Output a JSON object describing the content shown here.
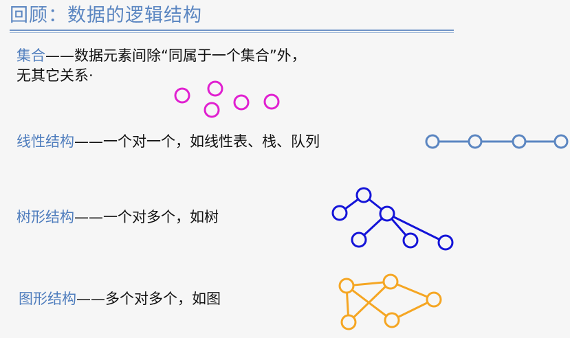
{
  "title": "回顾：数据的逻辑结构",
  "sections": {
    "set": {
      "term": "集合",
      "dash": "——",
      "desc1": "数据元素间除“同属于一个集合”外，",
      "desc2": "无其它关系·"
    },
    "linear": {
      "term": "线性结构",
      "dash": "——",
      "desc": "一个对一个，如线性表、栈、队列"
    },
    "tree": {
      "term": "树形结构",
      "dash": "——",
      "desc": "一个对多个，如树"
    },
    "graph": {
      "term": "图形结构",
      "dash": "——",
      "desc": "多个对多个，如图"
    }
  },
  "colors": {
    "title": "#5b86c1",
    "term": "#4f7dbd",
    "set_nodes": "#e020d0",
    "linear_nodes": "#5b86c1",
    "tree_nodes": "#1414d8",
    "graph_nodes": "#f5a623"
  }
}
